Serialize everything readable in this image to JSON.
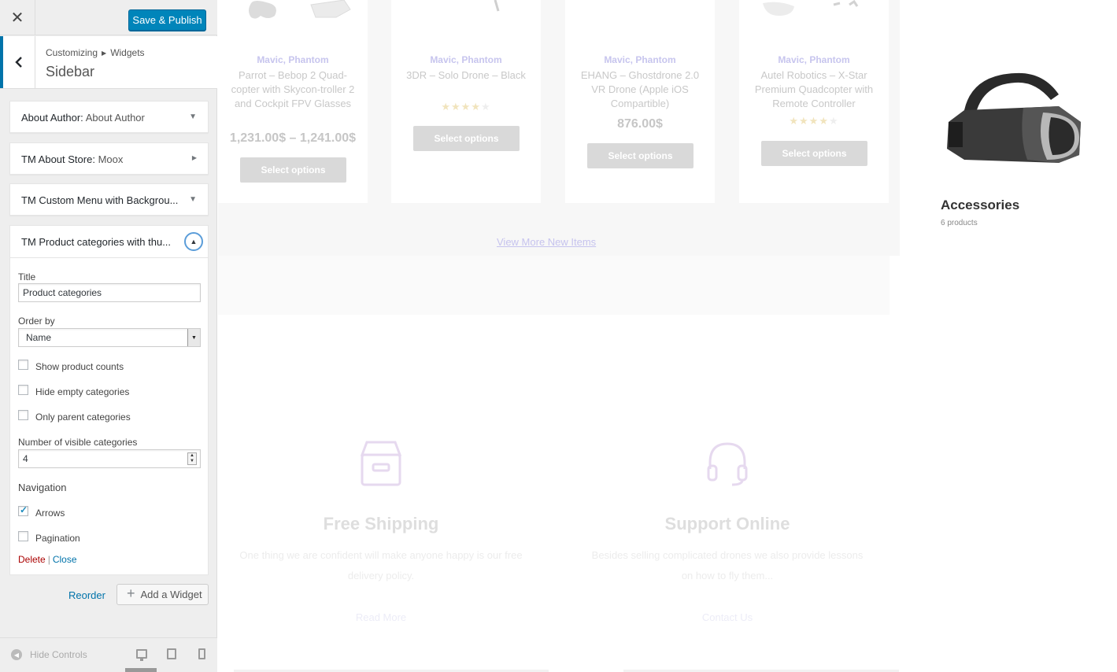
{
  "topbar": {
    "close_icon": "close-icon",
    "save_label": "Save & Publish"
  },
  "header": {
    "breadcrumb_parent": "Customizing",
    "breadcrumb_child": "Widgets",
    "title": "Sidebar"
  },
  "widgets": [
    {
      "name": "About Author:",
      "subtitle": "About Author",
      "toggle": "▼"
    },
    {
      "name": "TM About Store:",
      "subtitle": "Moox",
      "toggle": "▶"
    },
    {
      "name": "TM Custom Menu with Backgrou...",
      "subtitle": "",
      "toggle": "▼"
    }
  ],
  "open_widget": {
    "name": "TM Product categories with thu...",
    "title_label": "Title",
    "title_value": "Product categories",
    "orderby_label": "Order by",
    "orderby_value": "Name",
    "show_counts_label": "Show product counts",
    "hide_empty_label": "Hide empty categories",
    "only_parent_label": "Only parent categories",
    "num_label": "Number of visible categories",
    "num_value": "4",
    "nav_label": "Navigation",
    "arrows_label": "Arrows",
    "arrows_checked": true,
    "pagination_label": "Pagination",
    "pagination_checked": false,
    "show_counts_checked": false,
    "hide_empty_checked": false,
    "only_parent_checked": false,
    "delete_label": "Delete",
    "close_label": "Close"
  },
  "panel_actions": {
    "reorder_label": "Reorder",
    "add_widget_label": "Add a Widget"
  },
  "footer": {
    "hide_controls_label": "Hide Controls"
  },
  "preview": {
    "products": [
      {
        "category": "Mavic, Phantom",
        "name": "Parrot – Bebop 2 Quad-copter with Skycon-troller 2 and Cockpit FPV Glasses",
        "price": "1,231.00$ – 1,241.00$",
        "rating": 0,
        "button": "Select options"
      },
      {
        "category": "Mavic, Phantom",
        "name": "3DR – Solo Drone – Black",
        "price": "",
        "rating": 4,
        "button": "Select options"
      },
      {
        "category": "Mavic, Phantom",
        "name": "EHANG – Ghostdrone 2.0 VR Drone (Apple iOS Compartible)",
        "price": "876.00$",
        "rating": 0,
        "button": "Select options"
      },
      {
        "category": "Mavic, Phantom",
        "name": "Autel Robotics – X-Star Premium Quadcopter with Remote Controller",
        "price": "",
        "rating": 4,
        "button": "Select options"
      }
    ],
    "view_more": "View More New Items",
    "accessories": {
      "title": "Accessories",
      "count": "6 products"
    },
    "features": [
      {
        "heading": "Free Shipping",
        "text": "One thing we are confident will make anyone happy is our free delivery policy.",
        "link": "Read More"
      },
      {
        "heading": "Support Online",
        "text": "Besides selling complicated drones we also provide lessons on how to fly them...",
        "link": "Contact Us"
      }
    ]
  }
}
